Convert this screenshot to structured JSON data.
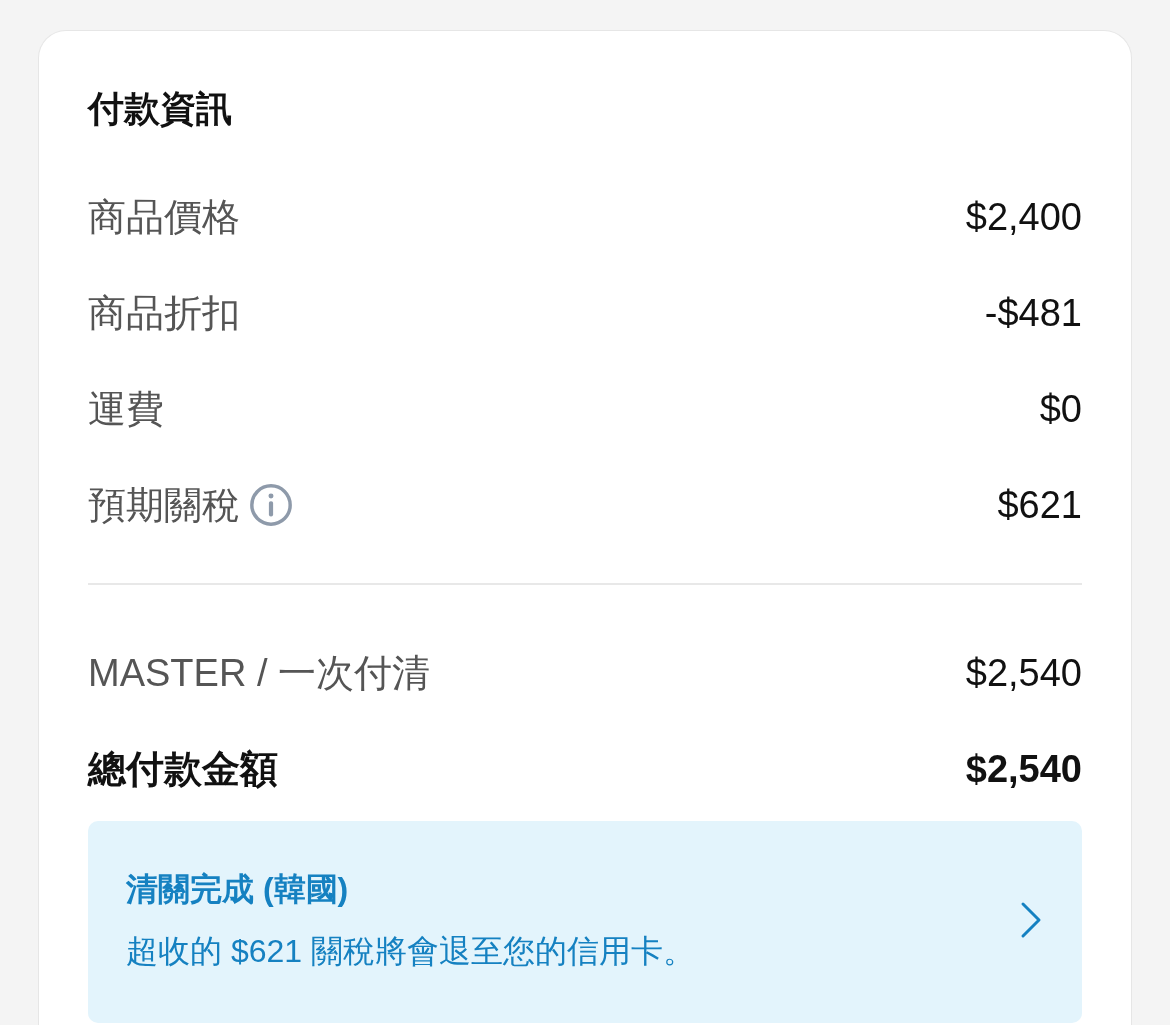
{
  "title": "付款資訊",
  "rows": [
    {
      "label": "商品價格",
      "value": "$2,400",
      "info": false
    },
    {
      "label": "商品折扣",
      "value": "-$481",
      "info": false
    },
    {
      "label": "運費",
      "value": "$0",
      "info": false
    },
    {
      "label": "預期關稅",
      "value": "$621",
      "info": true
    }
  ],
  "payment": {
    "label": "MASTER / 一次付清",
    "value": "$2,540"
  },
  "total": {
    "label": "總付款金額",
    "value": "$2,540"
  },
  "notice": {
    "title": "清關完成 (韓國)",
    "message": "超收的 $621 關稅將會退至您的信用卡。"
  }
}
